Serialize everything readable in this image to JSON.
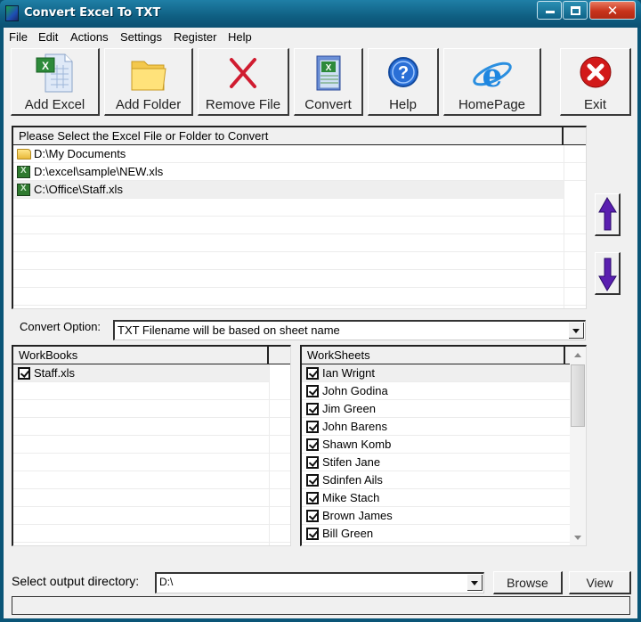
{
  "window": {
    "title": "Convert Excel To TXT",
    "controls": {
      "minimize": "minimize",
      "maximize": "maximize",
      "close": "✕"
    }
  },
  "menu": [
    "File",
    "Edit",
    "Actions",
    "Settings",
    "Register",
    "Help"
  ],
  "toolbar": [
    {
      "id": "add-excel",
      "label": "Add Excel",
      "icon": "excel-file-icon"
    },
    {
      "id": "add-folder",
      "label": "Add Folder",
      "icon": "folder-icon"
    },
    {
      "id": "remove-file",
      "label": "Remove File",
      "icon": "red-x-icon"
    },
    {
      "id": "convert",
      "label": "Convert",
      "icon": "excel-notepad-icon"
    },
    {
      "id": "help",
      "label": "Help",
      "icon": "help-question-icon"
    },
    {
      "id": "homepage",
      "label": "HomePage",
      "icon": "internet-explorer-icon"
    },
    {
      "id": "exit",
      "label": "Exit",
      "icon": "exit-circle-x-icon"
    }
  ],
  "file_list": {
    "header": "Please Select the Excel File or Folder to Convert",
    "items": [
      {
        "path": "D:\\My Documents",
        "type": "folder"
      },
      {
        "path": "D:\\excel\\sample\\NEW.xls",
        "type": "xls"
      },
      {
        "path": "C:\\Office\\Staff.xls",
        "type": "xls",
        "selected": true
      }
    ]
  },
  "reorder": {
    "up": "move-up",
    "down": "move-down"
  },
  "convert_option": {
    "label": "Convert Option:",
    "value": "TXT Filename will be based on sheet name"
  },
  "workbooks": {
    "header": "WorkBooks",
    "items": [
      {
        "name": "Staff.xls",
        "checked": true
      }
    ]
  },
  "worksheets": {
    "header": "WorkSheets",
    "items": [
      {
        "name": "Ian Wrignt",
        "checked": true
      },
      {
        "name": "John Godina",
        "checked": true
      },
      {
        "name": "Jim Green",
        "checked": true
      },
      {
        "name": "John Barens",
        "checked": true
      },
      {
        "name": "Shawn Komb",
        "checked": true
      },
      {
        "name": "Stifen Jane",
        "checked": true
      },
      {
        "name": "Sdinfen Ails",
        "checked": true
      },
      {
        "name": "Mike Stach",
        "checked": true
      },
      {
        "name": "Brown James",
        "checked": true
      },
      {
        "name": "Bill Green",
        "checked": true
      }
    ]
  },
  "output": {
    "label": "Select  output directory:",
    "value": "D:\\",
    "browse_label": "Browse",
    "view_label": "View"
  },
  "status_text": ""
}
